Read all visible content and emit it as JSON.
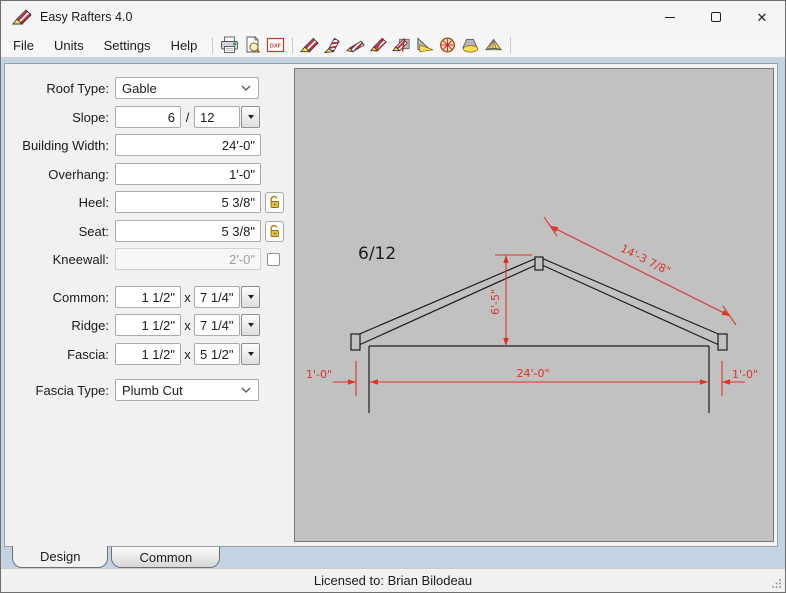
{
  "window": {
    "title": "Easy Rafters 4.0"
  },
  "menu": {
    "items": [
      {
        "label": "File"
      },
      {
        "label": "Units"
      },
      {
        "label": "Settings"
      },
      {
        "label": "Help"
      }
    ]
  },
  "toolbar": {
    "dxf_label": "DXF",
    "icons": [
      "print",
      "print-preview",
      "dxf-export",
      "common-rafter",
      "hip-rafter",
      "valley-rafter",
      "jack-rafter",
      "cripple-jack-rafter",
      "shed-roof",
      "round-tower-roof",
      "cone-roof",
      "gambrel-roof"
    ]
  },
  "form": {
    "roof_type": {
      "label": "Roof Type:",
      "value": "Gable"
    },
    "slope": {
      "label": "Slope:",
      "rise": "6",
      "separator": "/",
      "run": "12"
    },
    "building_width": {
      "label": "Building Width:",
      "value": "24'-0\""
    },
    "overhang": {
      "label": "Overhang:",
      "value": "1'-0\""
    },
    "heel": {
      "label": "Heel:",
      "value": "5 3/8\""
    },
    "seat": {
      "label": "Seat:",
      "value": "5 3/8\""
    },
    "kneewall": {
      "label": "Kneewall:",
      "value": "2'-0\"",
      "checked": false
    },
    "common": {
      "label": "Common:",
      "width": "1 1/2\"",
      "x": "x",
      "depth": "7 1/4\""
    },
    "ridge": {
      "label": "Ridge:",
      "width": "1 1/2\"",
      "x": "x",
      "depth": "7 1/4\""
    },
    "fascia": {
      "label": "Fascia:",
      "width": "1 1/2\"",
      "x": "x",
      "depth": "5 1/2\""
    },
    "fascia_type": {
      "label": "Fascia Type:",
      "value": "Plumb Cut"
    }
  },
  "drawing": {
    "slope_label": "6/12",
    "dim_rafter": "14'-3 7/8\"",
    "dim_rise": "6'-5\"",
    "dim_span": "24'-0\"",
    "dim_overhang_left": "1'-0\"",
    "dim_overhang_right": "1'-0\"",
    "colors": {
      "dimension": "#de3226",
      "line": "#1c1c1c",
      "canvas": "#c1c1c1"
    }
  },
  "tabs": [
    {
      "label": "Design",
      "active": true
    },
    {
      "label": "Common",
      "active": false
    }
  ],
  "statusbar": {
    "text": "Licensed to: Brian Bilodeau"
  }
}
